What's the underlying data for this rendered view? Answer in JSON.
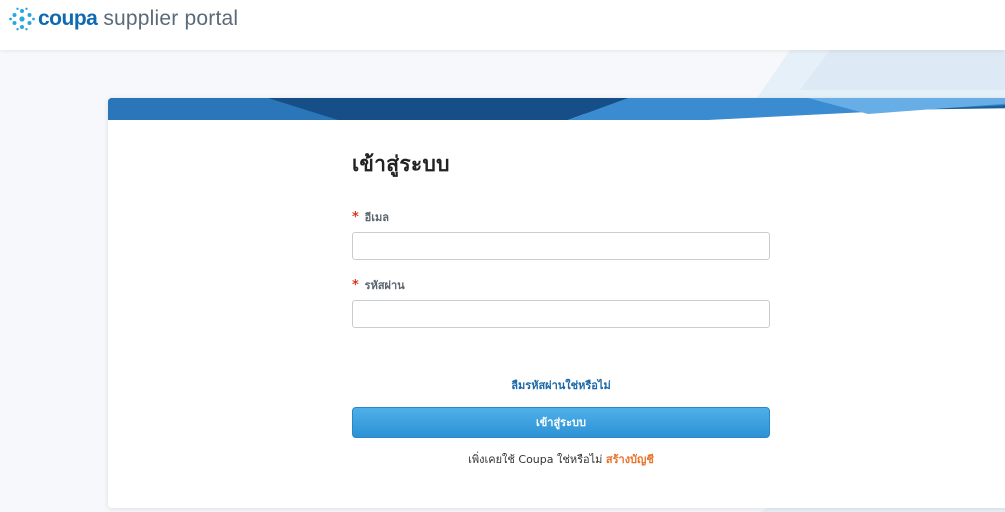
{
  "header": {
    "brand": "coupa",
    "brand_suffix": "supplier portal",
    "logo_icon": "coupa-logo-icon"
  },
  "login": {
    "title": "เข้าสู่ระบบ",
    "email_label": "อีเมล",
    "email_value": "",
    "password_label": "รหัสผ่าน",
    "password_value": "",
    "required_marker": "*",
    "forgot_link": "ลืมรหัสผ่านใช่หรือไม่",
    "submit_label": "เข้าสู่ระบบ",
    "signup_prompt": "เพิ่งเคยใช้ Coupa ใช่หรือไม่",
    "signup_link": "สร้างบัญชี"
  },
  "colors": {
    "brand_blue": "#0f6ab4",
    "button_blue": "#3aa0e0",
    "link_blue": "#1c68a8",
    "signup_orange": "#e8742a",
    "required_red": "#d9381e"
  }
}
